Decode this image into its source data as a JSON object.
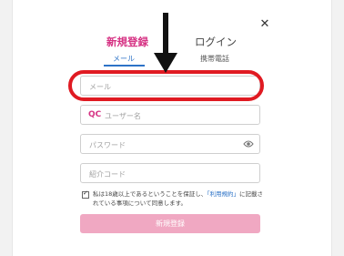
{
  "dialog": {
    "tabs": {
      "signup": "新規登録",
      "login": "ログイン"
    },
    "subtabs": {
      "email": "メール",
      "phone": "携帯電話"
    },
    "fields": {
      "email_placeholder": "メール",
      "user_prefix": "QC",
      "username_placeholder": "ユーザー名",
      "password_placeholder": "パスワード",
      "referral_placeholder": "紹介コード"
    },
    "agreement": {
      "checked": true,
      "text_before": "私は18歳以上であるということを保証し、",
      "terms_link": "「利用規約」",
      "text_after": "に記載されている事項について同意します。"
    },
    "submit_label": "新規登録"
  },
  "icons": {
    "close": "close-icon",
    "eye": "eye-icon",
    "checkbox": "checkbox-icon",
    "arrow": "down-arrow-annotation"
  },
  "colors": {
    "accent_pink": "#d63384",
    "link_blue": "#2d73c7",
    "highlight_red": "#e01a22",
    "submit_bg": "#f0a8c2"
  }
}
